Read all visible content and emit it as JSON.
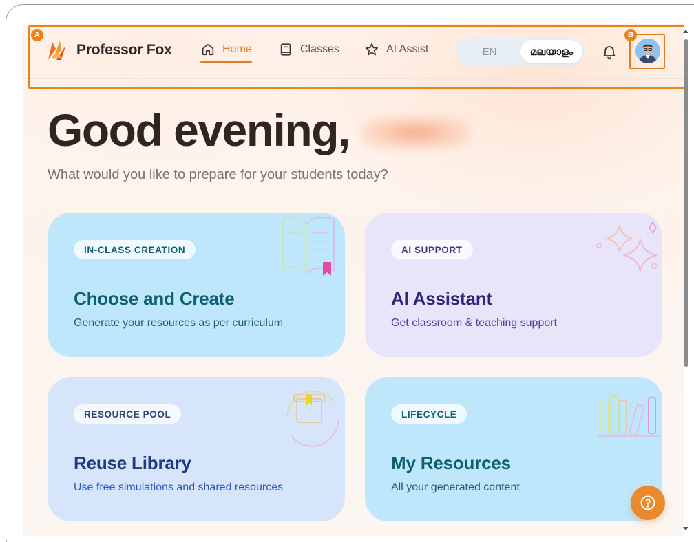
{
  "brand": {
    "name": "Professor Fox",
    "logo_icon": "fox-logo-icon"
  },
  "nav": {
    "items": [
      {
        "label": "Home",
        "icon": "home-icon",
        "active": true
      },
      {
        "label": "Classes",
        "icon": "book-icon",
        "active": false
      },
      {
        "label": "AI Assist",
        "icon": "star-icon",
        "active": false
      }
    ],
    "language": {
      "options": [
        "EN",
        "മലയാളം"
      ],
      "selected": "മലയാളം"
    },
    "bell_icon": "bell-icon",
    "avatar_icon": "user-avatar"
  },
  "annotations": {
    "a": "A",
    "b": "B"
  },
  "greeting": {
    "text": "Good evening,",
    "subtitle": "What would you like to prepare for your students today?"
  },
  "cards": [
    {
      "tag": "IN-CLASS CREATION",
      "title": "Choose and Create",
      "description": "Generate your resources as per curriculum",
      "color": "#bfe7fb"
    },
    {
      "tag": "AI SUPPORT",
      "title": "AI Assistant",
      "description": "Get classroom & teaching support",
      "color": "#e8e5fb"
    },
    {
      "tag": "RESOURCE POOL",
      "title": "Reuse Library",
      "description": "Use free simulations and shared resources",
      "color": "#d7e5fb"
    },
    {
      "tag": "LIFECYCLE",
      "title": "My Resources",
      "description": "All your generated content",
      "color": "#bfe7fb"
    }
  ],
  "help_icon": "help-icon",
  "colors": {
    "accent": "#e07b28",
    "badge": "#e9821f"
  }
}
